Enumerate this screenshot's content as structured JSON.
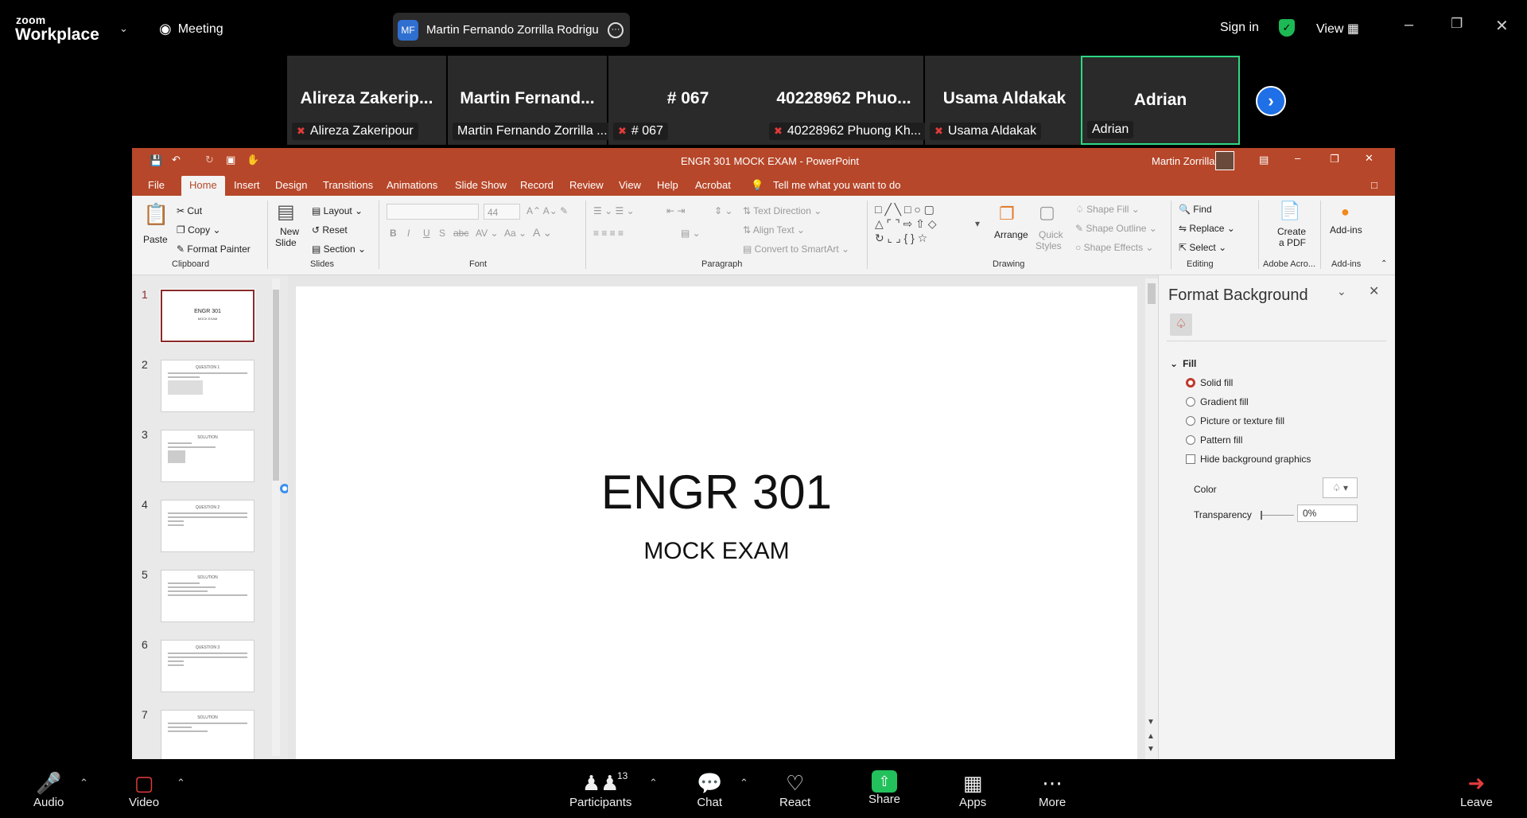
{
  "zoom": {
    "brand_small": "zoom",
    "brand_big": "Workplace",
    "meeting_label": "Meeting",
    "host_initials": "MF",
    "host_name": "Martin Fernando Zorrilla Rodrigu",
    "sign_in": "Sign in",
    "view_label": "View",
    "participants": [
      {
        "name": "Alireza  Zakerip...",
        "label": "Alireza Zakeripour",
        "muted": true
      },
      {
        "name": "Martin  Fernand...",
        "label": "Martin Fernando Zorrilla ...",
        "muted": false
      },
      {
        "name": "# 067",
        "label": "# 067",
        "muted": true
      },
      {
        "name": "40228962  Phuo...",
        "label": "40228962 Phuong Kh...",
        "muted": true
      },
      {
        "name": "Usama Aldakak",
        "label": "Usama Aldakak",
        "muted": true
      },
      {
        "name": "Adrian",
        "label": "Adrian",
        "muted": false
      }
    ],
    "toolbar": {
      "audio": "Audio",
      "video": "Video",
      "participants": "Participants",
      "participants_count": "13",
      "chat": "Chat",
      "react": "React",
      "share": "Share",
      "apps": "Apps",
      "more": "More",
      "leave": "Leave"
    }
  },
  "ppt": {
    "window_title": "ENGR 301 MOCK EXAM  -  PowerPoint",
    "user": "Martin Zorrilla",
    "tabs": [
      "File",
      "Home",
      "Insert",
      "Design",
      "Transitions",
      "Animations",
      "Slide Show",
      "Record",
      "Review",
      "View",
      "Help",
      "Acrobat"
    ],
    "tell_me": "Tell me what you want to do",
    "ribbon": {
      "paste": "Paste",
      "cut": "Cut",
      "copy": "Copy",
      "format_painter": "Format Painter",
      "clipboard": "Clipboard",
      "new_slide_1": "New",
      "new_slide_2": "Slide",
      "layout": "Layout",
      "reset": "Reset",
      "section": "Section",
      "slides": "Slides",
      "font_size": "44",
      "font": "Font",
      "text_direction": "Text Direction",
      "align_text": "Align Text",
      "convert_smartart": "Convert to SmartArt",
      "paragraph": "Paragraph",
      "arrange": "Arrange",
      "quick_1": "Quick",
      "quick_2": "Styles",
      "shape_fill": "Shape Fill",
      "shape_outline": "Shape Outline",
      "shape_effects": "Shape Effects",
      "drawing": "Drawing",
      "find": "Find",
      "replace": "Replace",
      "select": "Select",
      "editing": "Editing",
      "create_pdf_1": "Create",
      "create_pdf_2": "a PDF",
      "adobe": "Adobe Acro...",
      "addins": "Add-ins",
      "addins_grp": "Add-ins"
    },
    "thumbnails": [
      {
        "num": "1",
        "title": "ENGR 301",
        "sub": "MOCK EXAM"
      },
      {
        "num": "2",
        "title": "QUESTION 1",
        "sub": ""
      },
      {
        "num": "3",
        "title": "SOLUTION",
        "sub": ""
      },
      {
        "num": "4",
        "title": "QUESTION 2",
        "sub": ""
      },
      {
        "num": "5",
        "title": "SOLUTION",
        "sub": ""
      },
      {
        "num": "6",
        "title": "QUESTION 3",
        "sub": ""
      },
      {
        "num": "7",
        "title": "SOLUTION",
        "sub": ""
      }
    ],
    "slide": {
      "title": "ENGR 301",
      "subtitle": "MOCK EXAM"
    },
    "format_background": {
      "title": "Format Background",
      "fill": "Fill",
      "solid": "Solid fill",
      "gradient": "Gradient fill",
      "picture": "Picture or texture fill",
      "pattern": "Pattern fill",
      "hide": "Hide background graphics",
      "color": "Color",
      "transparency": "Transparency",
      "transparency_value": "0%"
    }
  }
}
